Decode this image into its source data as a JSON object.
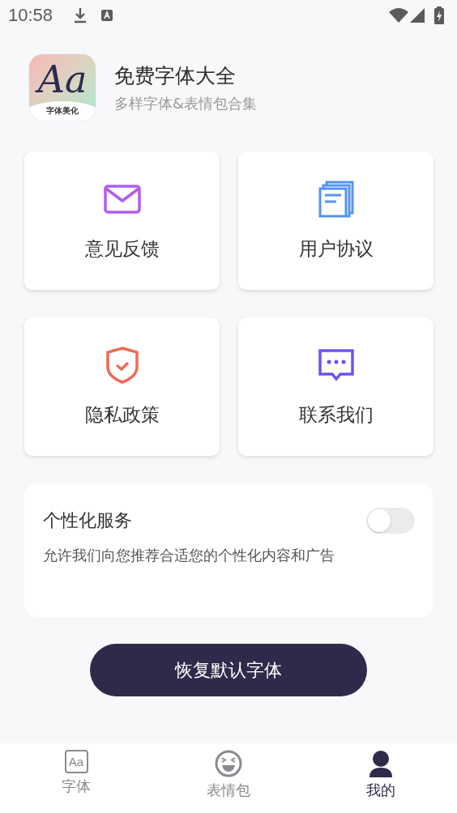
{
  "status_bar": {
    "time": "10:58"
  },
  "app": {
    "icon_text": "Aa",
    "icon_caption": "字体美化",
    "title": "免费字体大全",
    "subtitle": "多样字体&表情包合集"
  },
  "menu": [
    {
      "kind": "mail",
      "label": "意见反馈"
    },
    {
      "kind": "document",
      "label": "用户协议"
    },
    {
      "kind": "shield",
      "label": "隐私政策"
    },
    {
      "kind": "chat",
      "label": "联系我们"
    }
  ],
  "personalization": {
    "title": "个性化服务",
    "description": "允许我们向您推荐合适您的个性化内容和广告",
    "on": false
  },
  "reset_button": "恢复默认字体",
  "tabs": [
    {
      "kind": "font",
      "icon_text": "Aa",
      "label": "字体",
      "selected": false
    },
    {
      "kind": "emoji",
      "label": "表情包",
      "selected": false
    },
    {
      "kind": "profile",
      "label": "我的",
      "selected": true
    }
  ]
}
